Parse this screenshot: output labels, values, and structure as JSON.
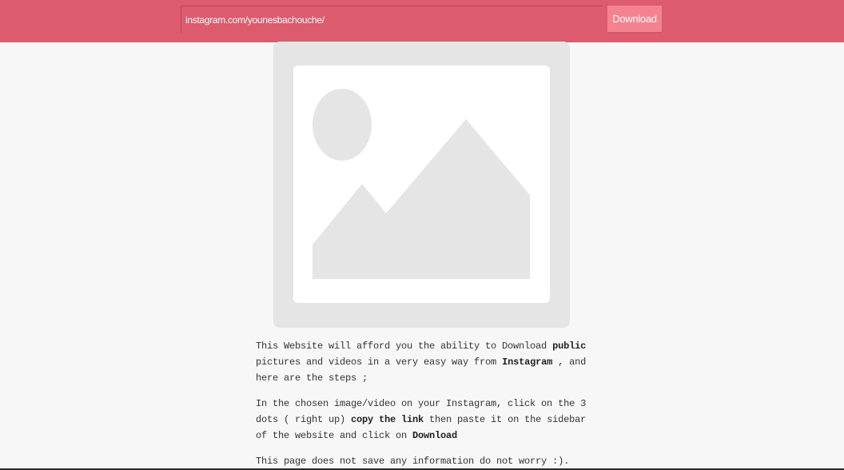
{
  "header": {
    "url_value": "instagram.com/younesbachouche/",
    "download_label": "Download"
  },
  "preview": {
    "icon": "image-placeholder-icon"
  },
  "description": {
    "p1_a": "This Website will afford you the ability to Download ",
    "p1_b": "public",
    "p1_c": " pictures and videos in a very easy way from ",
    "p1_d": "Instagram",
    "p1_e": " , and here are the steps ;",
    "p2_a": "In the chosen image/video on your Instagram, click on the 3 dots ( right up) ",
    "p2_b": "copy the link",
    "p2_c": " then paste it on the sidebar of the website and click on ",
    "p2_d": "Download",
    "p3": "This page does not save any information do not worry :)."
  },
  "colors": {
    "header_bg": "#dc5b6d",
    "button_bg": "#f4838f",
    "page_bg": "#f7f7f7",
    "placeholder_frame": "#e5e5e5",
    "placeholder_inner": "#ffffff"
  }
}
